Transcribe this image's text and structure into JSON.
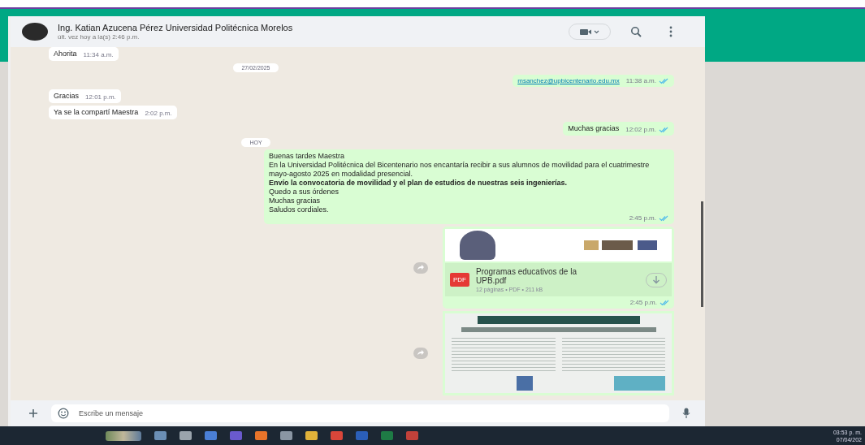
{
  "chat_header": {
    "name": "Ing. Katian Azucena Pérez Universidad Politécnica Morelos",
    "status": "últ. vez hoy a la(s) 2:46 p.m."
  },
  "messages": [
    {
      "kind": "text",
      "outgoing": false,
      "lines": [
        "Ahorita"
      ],
      "time": "11:34 a.m."
    },
    {
      "kind": "date",
      "text": "27/02/2025"
    },
    {
      "kind": "link",
      "outgoing": true,
      "text": "msanchez@upbicentenario.edu.mx",
      "time": "11:38 a.m.",
      "read": true
    },
    {
      "kind": "text",
      "outgoing": false,
      "lines": [
        "Gracias"
      ],
      "time": "12:01 p.m."
    },
    {
      "kind": "text",
      "outgoing": false,
      "lines": [
        "Ya se la compartí Maestra"
      ],
      "time": "2:02 p.m."
    },
    {
      "kind": "text",
      "outgoing": true,
      "lines": [
        "Muchas gracias"
      ],
      "time": "12:02 p.m.",
      "read": true
    },
    {
      "kind": "date",
      "text": "HOY"
    },
    {
      "kind": "text",
      "outgoing": true,
      "lines": [
        "Buenas tardes Maestra",
        "En la Universidad Politécnica del Bicentenario nos encantaría recibir a sus alumnos de movilidad para el cuatrimestre mayo-agosto 2025 en modalidad presencial.",
        "**Envío la convocatoria de movilidad y el plan de estudios de nuestras seis ingenierías.**",
        "Quedo a sus órdenes",
        "Muchas gracias",
        "Saludos cordiales."
      ],
      "time": "2:45 p.m.",
      "read": true
    },
    {
      "kind": "document",
      "outgoing": true,
      "file_name": "Programas educativos de la UPB.pdf",
      "file_type": "PDF",
      "details": "12 páginas • PDF • 211 kB",
      "time": "2:45 p.m.",
      "read": true
    },
    {
      "kind": "image",
      "outgoing": true
    }
  ],
  "composer": {
    "placeholder": "Escribe un mensaje"
  },
  "taskbar": {
    "time": "03:53 p. m.",
    "date": "07/04/202"
  }
}
